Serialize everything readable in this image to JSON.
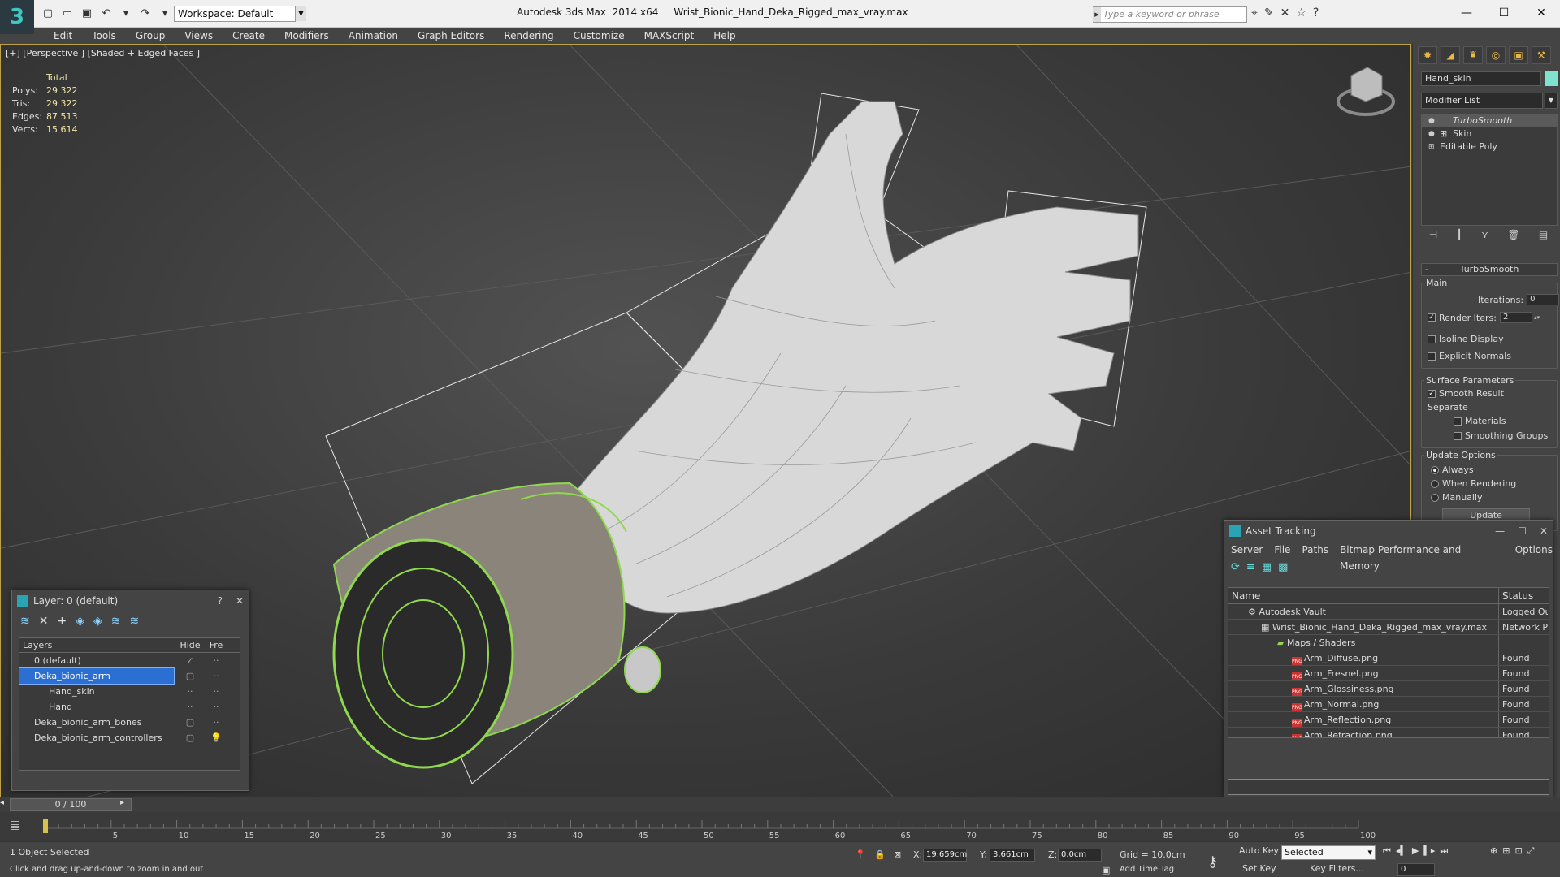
{
  "app": {
    "logo": "3",
    "workspace": "Workspace: Default",
    "title": "Autodesk 3ds Max  2014 x64     Wrist_Bionic_Hand_Deka_Rigged_max_vray.max",
    "search_placeholder": "Type a keyword or phrase"
  },
  "menu": [
    "Edit",
    "Tools",
    "Group",
    "Views",
    "Create",
    "Modifiers",
    "Animation",
    "Graph Editors",
    "Rendering",
    "Customize",
    "MAXScript",
    "Help"
  ],
  "viewport": {
    "label": "[+] [Perspective ] [Shaded + Edged Faces ]",
    "stats": {
      "total_label": "Total",
      "rows": [
        {
          "k": "Polys:",
          "v": "29 322"
        },
        {
          "k": "Tris:",
          "v": "29 322"
        },
        {
          "k": "Edges:",
          "v": "87 513"
        },
        {
          "k": "Verts:",
          "v": "15 614"
        }
      ]
    }
  },
  "command_panel": {
    "object_name": "Hand_skin",
    "object_color": "#7fe2cf",
    "modifier_list": "Modifier List",
    "stack": [
      "TurboSmooth",
      "Skin",
      "Editable Poly"
    ],
    "rollout_title": "TurboSmooth",
    "main_label": "Main",
    "iterations_label": "Iterations:",
    "iterations_value": "0",
    "render_iters_label": "Render Iters:",
    "render_iters_value": "2",
    "isoline": "Isoline Display",
    "explicit_normals": "Explicit Normals",
    "surface_params": "Surface Parameters",
    "smooth_result": "Smooth Result",
    "separate": "Separate",
    "materials": "Materials",
    "smoothing_groups": "Smoothing Groups",
    "update_options": "Update Options",
    "always": "Always",
    "when_rendering": "When Rendering",
    "manually": "Manually",
    "update_button": "Update"
  },
  "layer_dialog": {
    "title": "Layer: 0 (default)",
    "help": "?",
    "col_layers": "Layers",
    "col_hide": "Hide",
    "col_freeze": "Fre",
    "rows": [
      {
        "name": "0 (default)",
        "indent": 1
      },
      {
        "name": "Deka_bionic_arm",
        "indent": 1
      },
      {
        "name": "Hand_skin",
        "indent": 2
      },
      {
        "name": "Hand",
        "indent": 2
      },
      {
        "name": "Deka_bionic_arm_bones",
        "indent": 1
      },
      {
        "name": "Deka_bionic_arm_controllers",
        "indent": 1
      }
    ]
  },
  "asset_dialog": {
    "title": "Asset Tracking",
    "menu": [
      "Server",
      "File",
      "Paths",
      "Bitmap Performance and Memory",
      "Options"
    ],
    "col_name": "Name",
    "col_status": "Status",
    "rows": [
      {
        "name": "Autodesk Vault",
        "status": "Logged Ou",
        "indent": 1,
        "png": false
      },
      {
        "name": "Wrist_Bionic_Hand_Deka_Rigged_max_vray.max",
        "status": "Network P",
        "indent": 2,
        "png": false
      },
      {
        "name": "Maps / Shaders",
        "status": "",
        "indent": 3,
        "png": false
      },
      {
        "name": "Arm_Diffuse.png",
        "status": "Found",
        "indent": 4,
        "png": true
      },
      {
        "name": "Arm_Fresnel.png",
        "status": "Found",
        "indent": 4,
        "png": true
      },
      {
        "name": "Arm_Glossiness.png",
        "status": "Found",
        "indent": 4,
        "png": true
      },
      {
        "name": "Arm_Normal.png",
        "status": "Found",
        "indent": 4,
        "png": true
      },
      {
        "name": "Arm_Reflection.png",
        "status": "Found",
        "indent": 4,
        "png": true
      },
      {
        "name": "Arm_Refraction.png",
        "status": "Found",
        "indent": 4,
        "png": true
      }
    ]
  },
  "timeline": {
    "frame": "0 / 100",
    "ticks": [
      "0",
      "5",
      "10",
      "15",
      "20",
      "25",
      "30",
      "35",
      "40",
      "45",
      "50",
      "55",
      "60",
      "65",
      "70",
      "75",
      "80",
      "85",
      "90",
      "95",
      "100"
    ]
  },
  "status": {
    "selected": "1 Object Selected",
    "hint": "Click and drag up-and-down to zoom in and out",
    "x_label": "X:",
    "x_value": "19.659cm",
    "y_label": "Y:",
    "y_value": "3.661cm",
    "z_label": "Z:",
    "z_value": "0.0cm",
    "grid": "Grid = 10.0cm",
    "add_time_tag": "Add Time Tag",
    "auto_key": "Auto Key",
    "set_key": "Set Key",
    "selected_dd": "Selected",
    "key_filters": "Key Filters...",
    "frame_field": "0"
  }
}
